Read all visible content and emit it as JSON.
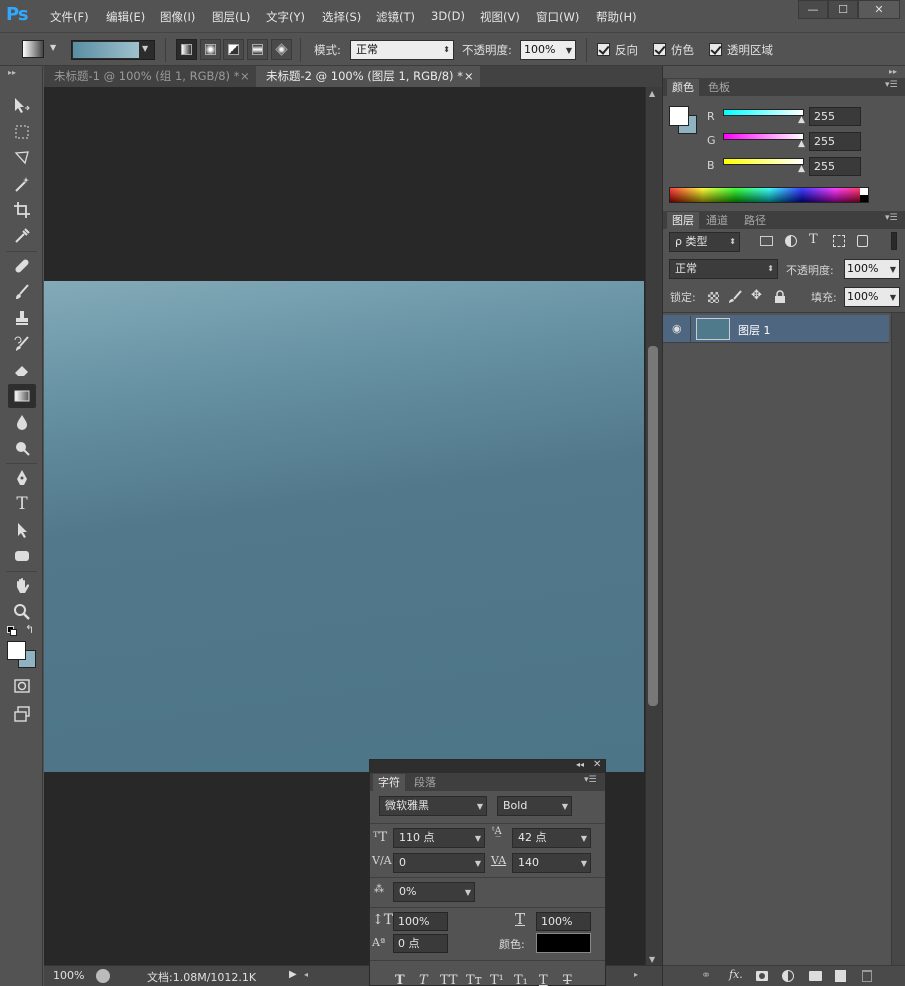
{
  "app": {
    "logo": "Ps"
  },
  "menu": [
    {
      "label": "文件(F)"
    },
    {
      "label": "编辑(E)"
    },
    {
      "label": "图像(I)"
    },
    {
      "label": "图层(L)"
    },
    {
      "label": "文字(Y)"
    },
    {
      "label": "选择(S)"
    },
    {
      "label": "滤镜(T)"
    },
    {
      "label": "3D(D)"
    },
    {
      "label": "视图(V)"
    },
    {
      "label": "窗口(W)"
    },
    {
      "label": "帮助(H)"
    }
  ],
  "window_controls": {
    "minimize": "—",
    "maximize": "☐",
    "close": "✕"
  },
  "options": {
    "mode_label": "模式:",
    "mode_value": "正常",
    "opacity_label": "不透明度:",
    "opacity_value": "100%",
    "reverse_label": "反向",
    "dither_label": "仿色",
    "transparency_label": "透明区域"
  },
  "tabs": [
    {
      "title": "未标题-1 @ 100% (组 1, RGB/8) *",
      "close": "×"
    },
    {
      "title": "未标题-2 @ 100% (图层 1, RGB/8) *",
      "close": "×"
    }
  ],
  "status": {
    "zoom": "100%",
    "doc_info": "文档:1.08M/1012.1K"
  },
  "color_panel": {
    "tabs": [
      "颜色",
      "色板"
    ],
    "channels": [
      {
        "label": "R",
        "value": "255"
      },
      {
        "label": "G",
        "value": "255"
      },
      {
        "label": "B",
        "value": "255"
      }
    ]
  },
  "layers_panel": {
    "tabs": [
      "图层",
      "通道",
      "路径"
    ],
    "filter_label": "ρ 类型",
    "blend_mode": "正常",
    "opacity_label": "不透明度:",
    "opacity_value": "100%",
    "lock_label": "锁定:",
    "fill_label": "填充:",
    "fill_value": "100%",
    "layers": [
      {
        "name": "图层 1"
      }
    ]
  },
  "char_panel": {
    "tabs": [
      "字符",
      "段落"
    ],
    "font_family": "微软雅黑",
    "font_style": "Bold",
    "font_size": "110 点",
    "leading": "42 点",
    "kerning": "0",
    "tracking": "140",
    "scale_pct": "0%",
    "vertical_scale": "100%",
    "horizontal_scale": "100%",
    "baseline_shift": "0 点",
    "color_label": "颜色:",
    "style_buttons": [
      "T",
      "T",
      "TT",
      "Tт",
      "T¹",
      "T₁",
      "T",
      "T"
    ]
  },
  "colors": {
    "foreground": "#ffffff",
    "background": "#8fb3c0",
    "layer_selected": "#4f6680",
    "text_color": "#000000"
  }
}
